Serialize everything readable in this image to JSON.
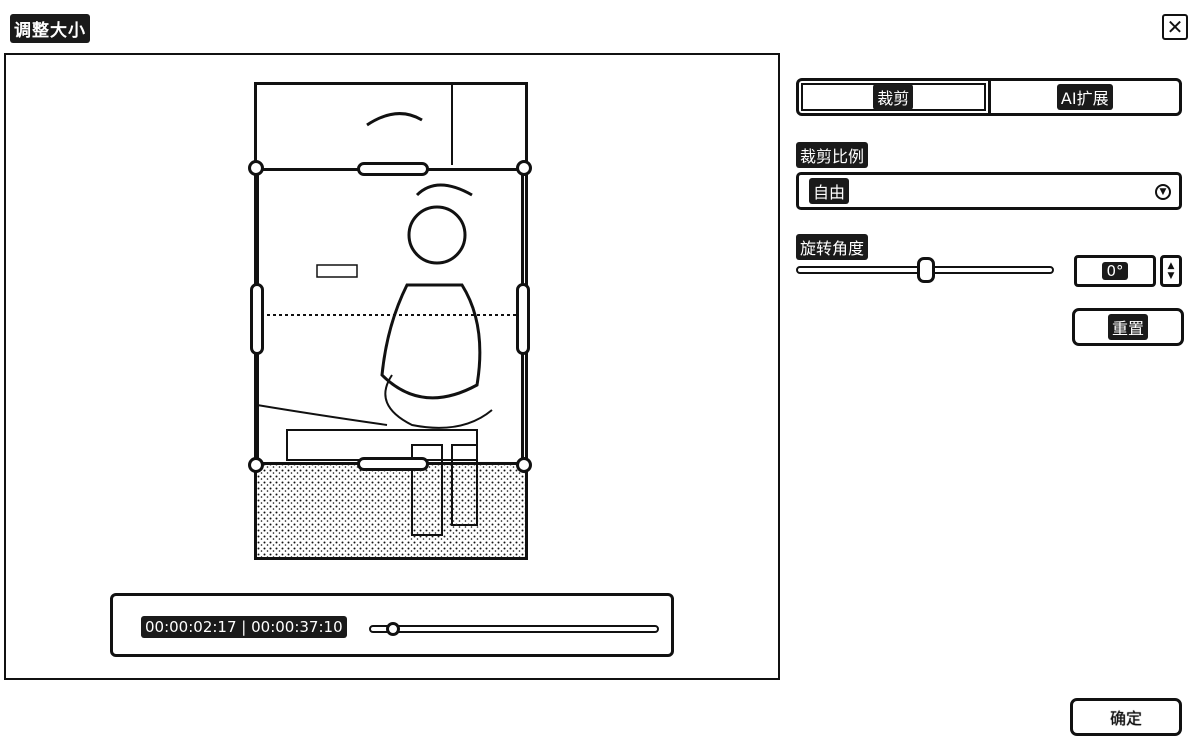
{
  "window": {
    "title": "调整大小"
  },
  "preview": {
    "time_current": "00:00:02:17",
    "time_separator": " | ",
    "time_total": "00:00:37:10",
    "playhead_fraction": 0.06
  },
  "panel": {
    "tabs": [
      {
        "label": "裁剪",
        "active": true
      },
      {
        "label": "AI扩展",
        "active": false
      }
    ],
    "crop_ratio_label": "裁剪比例",
    "crop_ratio_value": "自由",
    "rotation_label": "旋转角度",
    "rotation_value": "0°",
    "rotation_fraction": 0.5,
    "reset_label": "重置"
  },
  "footer": {
    "ok_label": "确定"
  },
  "icons": {
    "close": "close-icon",
    "dropdown": "chevron-down-icon",
    "spinner": "spinner-arrows-icon"
  }
}
